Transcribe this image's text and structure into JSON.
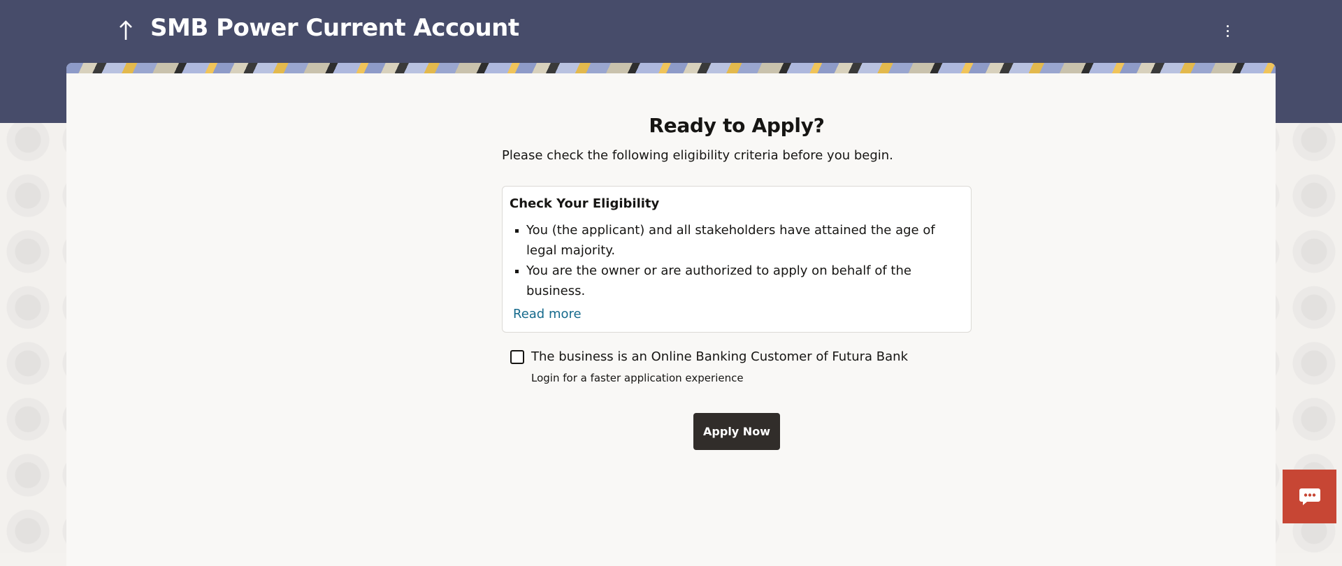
{
  "header": {
    "title": "SMB Power Current Account",
    "back_icon": "arrow-up-icon",
    "menu_icon": "kebab-menu-icon"
  },
  "main": {
    "heading": "Ready to Apply?",
    "intro": "Please check the following eligibility criteria before you begin.",
    "eligibility": {
      "title": "Check Your Eligibility",
      "criteria": [
        "You (the applicant) and all stakeholders have attained the age of legal majority.",
        "You are the owner or are authorized to apply on behalf of the business."
      ],
      "read_more": "Read more"
    },
    "customer_checkbox": {
      "label": "The business is an Online Banking Customer of Futura Bank",
      "helper": "Login for a faster application experience",
      "checked": false
    },
    "apply_button": "Apply Now"
  },
  "chat": {
    "icon": "chat-bubble-icon"
  },
  "colors": {
    "header_bg": "#474c6a",
    "apply_bg": "#312d2a",
    "link": "#166a8c",
    "chat_bg": "#c74634"
  }
}
